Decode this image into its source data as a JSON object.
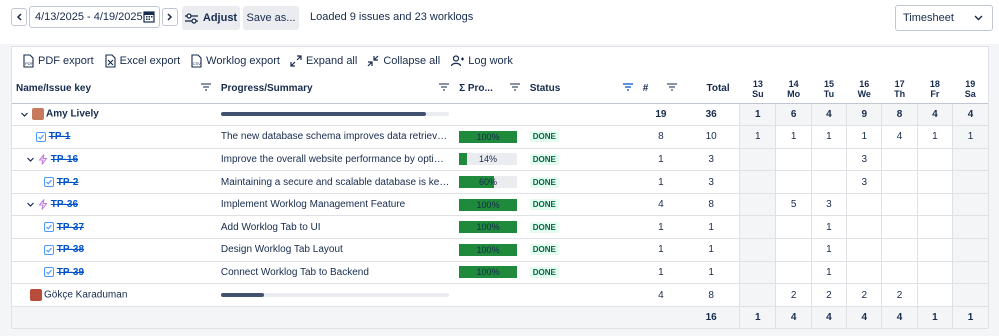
{
  "topbar": {
    "date_range": "4/13/2025 - 4/19/2025",
    "adjust_label": "Adjust",
    "save_label": "Save as...",
    "status": "Loaded 9 issues and 23 worklogs",
    "view_select": "Timesheet"
  },
  "toolbar": {
    "pdf": "PDF export",
    "excel": "Excel export",
    "worklog": "Worklog export",
    "expand": "Expand all",
    "collapse": "Collapse all",
    "log": "Log work"
  },
  "table": {
    "headers": {
      "name": "Name/Issue key",
      "summary": "Progress/Summary",
      "progress": "Σ Pro...",
      "status": "Status",
      "count": "#",
      "total": "Total"
    },
    "days": [
      {
        "num": "13",
        "dow": "Su"
      },
      {
        "num": "14",
        "dow": "Mo"
      },
      {
        "num": "15",
        "dow": "Tu"
      },
      {
        "num": "16",
        "dow": "We"
      },
      {
        "num": "17",
        "dow": "Th"
      },
      {
        "num": "18",
        "dow": "Fr"
      },
      {
        "num": "19",
        "dow": "Sa"
      }
    ],
    "rows": [
      {
        "kind": "user",
        "name": "Amy Lively",
        "user_progress": 0.9,
        "count": "19",
        "total": "36",
        "days": [
          "1",
          "6",
          "4",
          "9",
          "8",
          "4",
          "4"
        ]
      },
      {
        "kind": "issue",
        "indent": 1,
        "type": "task",
        "key": "TP-1",
        "summary": "The new database schema improves data retrieval ti...",
        "progress": "100%",
        "progress_value": 1.0,
        "status": "DONE",
        "count": "8",
        "total": "10",
        "days": [
          "1",
          "1",
          "1",
          "1",
          "4",
          "1",
          "1"
        ]
      },
      {
        "kind": "issue",
        "indent": 1,
        "type": "epic",
        "expand": true,
        "key": "TP-16",
        "summary": "Improve the overall website performance by optimizi...",
        "progress": "14%",
        "progress_value": 0.14,
        "status": "DONE",
        "count": "1",
        "total": "3",
        "days": [
          "",
          "",
          "",
          "3",
          "",
          "",
          ""
        ]
      },
      {
        "kind": "issue",
        "indent": 2,
        "type": "task",
        "key": "TP-2",
        "summary": "Maintaining a secure and scalable database is key to...",
        "progress": "60%",
        "progress_value": 0.6,
        "status": "DONE",
        "count": "1",
        "total": "3",
        "days": [
          "",
          "",
          "",
          "3",
          "",
          "",
          ""
        ]
      },
      {
        "kind": "issue",
        "indent": 1,
        "type": "epic",
        "expand": true,
        "key": "TP-36",
        "summary": "Implement Worklog Management Feature",
        "progress": "100%",
        "progress_value": 1.0,
        "status": "DONE",
        "count": "4",
        "total": "8",
        "days": [
          "",
          "5",
          "3",
          "",
          "",
          "",
          ""
        ]
      },
      {
        "kind": "issue",
        "indent": 2,
        "type": "task",
        "key": "TP-37",
        "summary": "Add Worklog Tab to UI",
        "progress": "100%",
        "progress_value": 1.0,
        "status": "DONE",
        "count": "1",
        "total": "1",
        "days": [
          "",
          "",
          "1",
          "",
          "",
          "",
          ""
        ]
      },
      {
        "kind": "issue",
        "indent": 2,
        "type": "task",
        "key": "TP-38",
        "summary": "Design Worklog Tab Layout",
        "progress": "100%",
        "progress_value": 1.0,
        "status": "DONE",
        "count": "1",
        "total": "1",
        "days": [
          "",
          "",
          "1",
          "",
          "",
          "",
          ""
        ]
      },
      {
        "kind": "issue",
        "indent": 2,
        "type": "task",
        "key": "TP-39",
        "summary": "Connect Worklog Tab to Backend",
        "progress": "100%",
        "progress_value": 1.0,
        "status": "DONE",
        "count": "1",
        "total": "1",
        "days": [
          "",
          "",
          "1",
          "",
          "",
          "",
          ""
        ]
      },
      {
        "kind": "user2",
        "name": "Gökçe Karaduman",
        "user_progress": 0.19,
        "count": "4",
        "total": "8",
        "days": [
          "",
          "2",
          "2",
          "2",
          "2",
          "",
          ""
        ]
      }
    ],
    "totals": {
      "total": "16",
      "days": [
        "1",
        "4",
        "4",
        "4",
        "4",
        "1",
        "1"
      ]
    }
  },
  "colors": {
    "done_bar": "#1f8a3b",
    "key_link": "#0052cc",
    "shade": "#f4f5f7"
  }
}
